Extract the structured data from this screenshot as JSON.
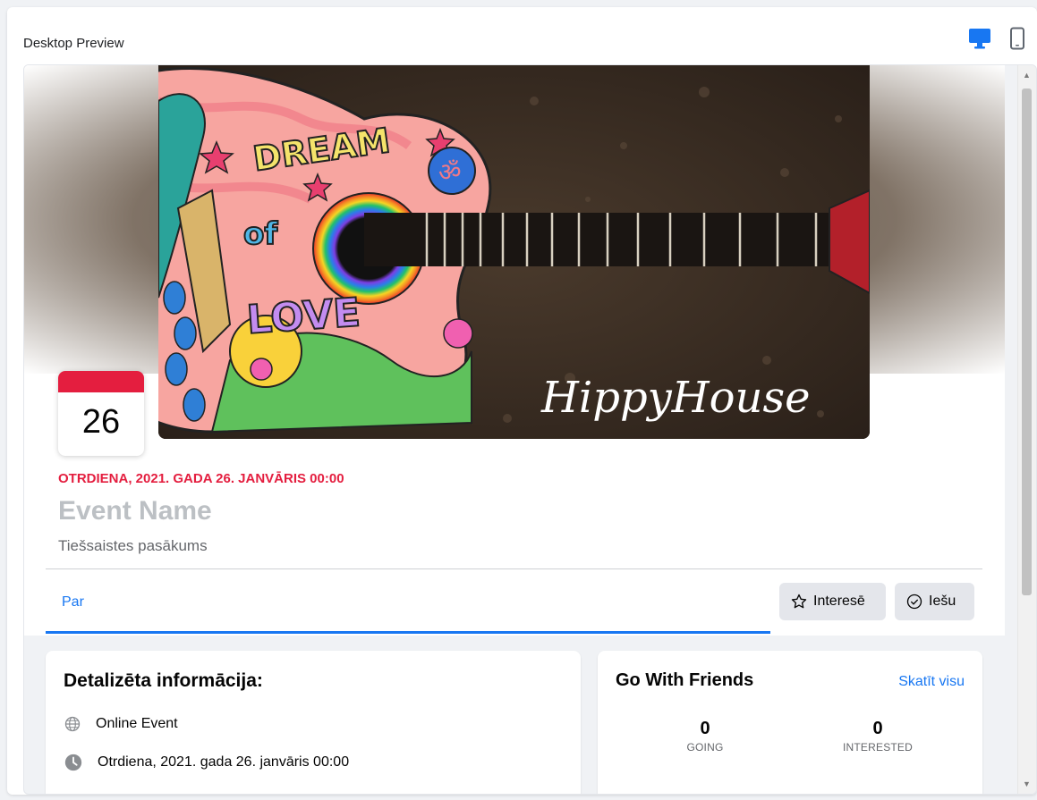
{
  "panel": {
    "title": "Desktop Preview",
    "desktop_icon": "desktop-monitor-icon",
    "mobile_icon": "mobile-phone-icon",
    "accent_color": "#1877f2"
  },
  "cover": {
    "title_text": "HippyHouse",
    "art_text_1": "DREAM",
    "art_text_2": "of",
    "art_text_3": "LOVE"
  },
  "event": {
    "day": "26",
    "datetime": "OTRDIENA, 2021. GADA 26. JANVĀRIS 00:00",
    "name": "Event Name",
    "location": "Tiešsaistes pasākums",
    "date_color": "#e41e3f"
  },
  "tabs": {
    "about": "Par"
  },
  "actions": {
    "interested": "Interesē",
    "going": "Iešu"
  },
  "details": {
    "title": "Detalizēta informācija:",
    "rows": [
      {
        "icon": "globe-icon",
        "text": "Online Event"
      },
      {
        "icon": "clock-icon",
        "text": "Otrdiena, 2021. gada 26. janvāris 00:00"
      }
    ]
  },
  "friends": {
    "title": "Go With Friends",
    "see_all": "Skatīt visu",
    "stats": [
      {
        "value": "0",
        "label": "GOING"
      },
      {
        "value": "0",
        "label": "INTERESTED"
      }
    ]
  }
}
